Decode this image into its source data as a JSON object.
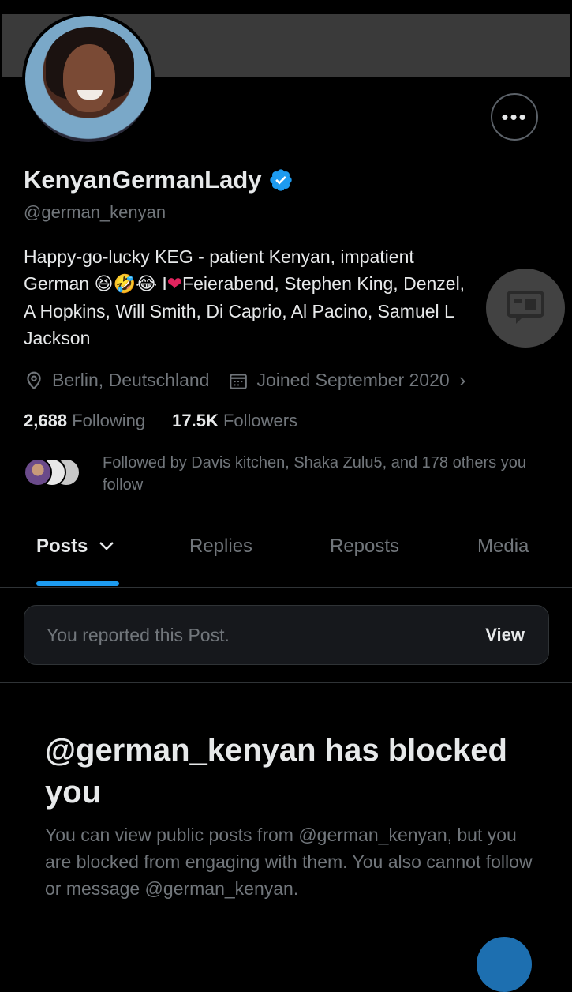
{
  "profile": {
    "display_name": "KenyanGermanLady",
    "handle": "@german_kenyan",
    "bio_line1": "Happy-go-lucky KEG - patient Kenyan, impatient",
    "bio_line2_pre": "German ",
    "bio_emojis": "😆🤣😂",
    "bio_line2_i": " I",
    "bio_heart": "❤",
    "bio_line2_post": "Feierabend, Stephen King, Denzel,",
    "bio_line3": "A Hopkins, Will Smith, Di Caprio, Al Pacino, Samuel L",
    "bio_line4": "Jackson",
    "location": "Berlin, Deutschland",
    "joined": "Joined September 2020",
    "following_count": "2,688",
    "following_label": "Following",
    "followers_count": "17.5K",
    "followers_label": "Followers",
    "followed_by": "Followed by Davis kitchen, Shaka Zulu5, and 178 others you follow"
  },
  "tabs": [
    {
      "label": "Posts",
      "active": true
    },
    {
      "label": "Replies"
    },
    {
      "label": "Reposts"
    },
    {
      "label": "Media"
    }
  ],
  "report": {
    "text": "You reported this Post.",
    "action": "View"
  },
  "blocked": {
    "title": "@german_kenyan has blocked you",
    "body": "You can view public posts from @german_kenyan, but you are blocked from engaging with them. You also cannot follow or message @german_kenyan."
  },
  "icons": {
    "more": "more-icon",
    "verified": "verified-badge-icon",
    "location": "location-pin-icon",
    "calendar": "calendar-icon",
    "chevron": "chevron-right-icon",
    "tab_chevron": "chevron-down-icon"
  },
  "colors": {
    "accent": "#1d9bf0",
    "background": "#000000",
    "text_primary": "#e7e9ea",
    "text_secondary": "#71767b"
  }
}
